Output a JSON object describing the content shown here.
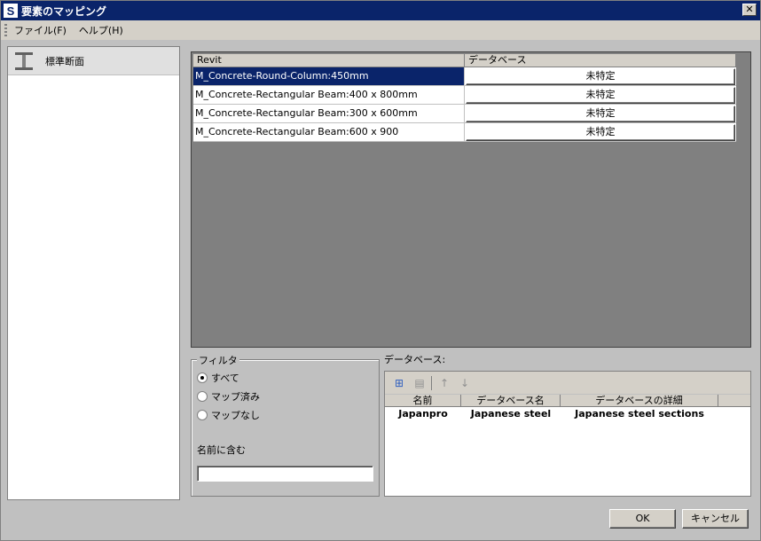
{
  "window": {
    "title": "要素のマッピング",
    "app_icon": "S",
    "close_glyph": "✕"
  },
  "menu": [
    "ファイル(F)",
    "ヘルプ(H)"
  ],
  "sidebar": {
    "items": [
      {
        "label": "標準断面",
        "icon": "i-beam-icon"
      }
    ]
  },
  "grid": {
    "columns": [
      "Revit",
      "データベース"
    ],
    "rows": [
      {
        "name": "M_Concrete-Round-Column:450mm",
        "value": "未特定",
        "selected": true
      },
      {
        "name": "M_Concrete-Rectangular Beam:400 x 800mm",
        "value": "未特定",
        "selected": false
      },
      {
        "name": "M_Concrete-Rectangular Beam:300 x 600mm",
        "value": "未特定",
        "selected": false
      },
      {
        "name": "M_Concrete-Rectangular Beam:600 x 900",
        "value": "未特定",
        "selected": false
      }
    ]
  },
  "filter": {
    "title": "フィルタ",
    "options": [
      {
        "label": "すべて",
        "checked": true
      },
      {
        "label": "マップ済み",
        "checked": false
      },
      {
        "label": "マップなし",
        "checked": false
      }
    ],
    "contains_label": "名前に含む",
    "contains_value": ""
  },
  "database": {
    "label": "データベース:",
    "toolbar_icons": [
      "add-icon",
      "remove-icon",
      "up-arrow-icon",
      "down-arrow-icon"
    ],
    "columns": [
      "名前",
      "データベース名",
      "データベースの詳細"
    ],
    "rows": [
      {
        "name": "Japanpro",
        "db_name": "Japanese steel",
        "details": "Japanese steel sections"
      }
    ]
  },
  "buttons": {
    "ok": "OK",
    "cancel": "キャンセル"
  },
  "colors": {
    "titlebar": "#0a246a",
    "selection": "#0a246a",
    "grid_background": "#808080"
  }
}
